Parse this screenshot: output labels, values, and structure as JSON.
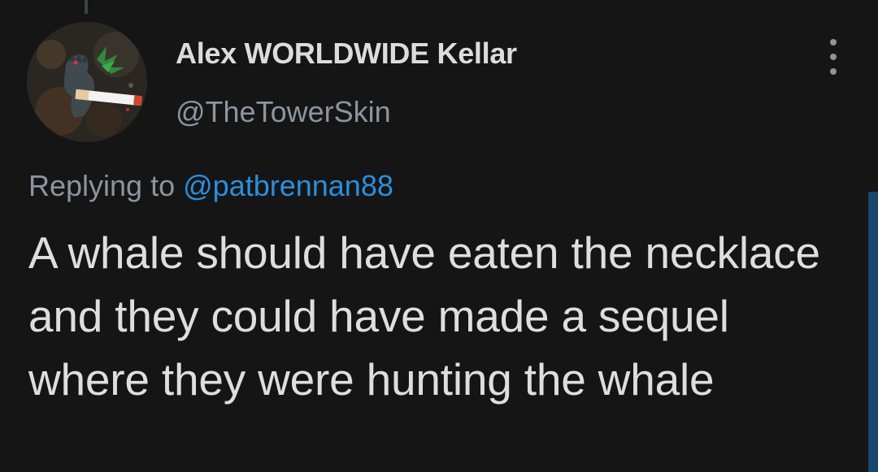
{
  "tweet": {
    "author_name": "Alex WORLDWIDE Kellar",
    "author_handle": "@TheTowerSkin",
    "avatar_icon": "godzilla-avatar-icon",
    "more_icon": "more-vertical-icon",
    "reply_prefix": "Replying to",
    "reply_to_handle": "@patbrennan88",
    "text": "A whale should have eaten the necklace and they could have made a sequel where they were hunting the whale"
  },
  "colors": {
    "background": "#151516",
    "primary_text": "#dedede",
    "secondary_text": "#8b959f",
    "link": "#2b8fdc",
    "scroll_indicator": "#19466b"
  }
}
